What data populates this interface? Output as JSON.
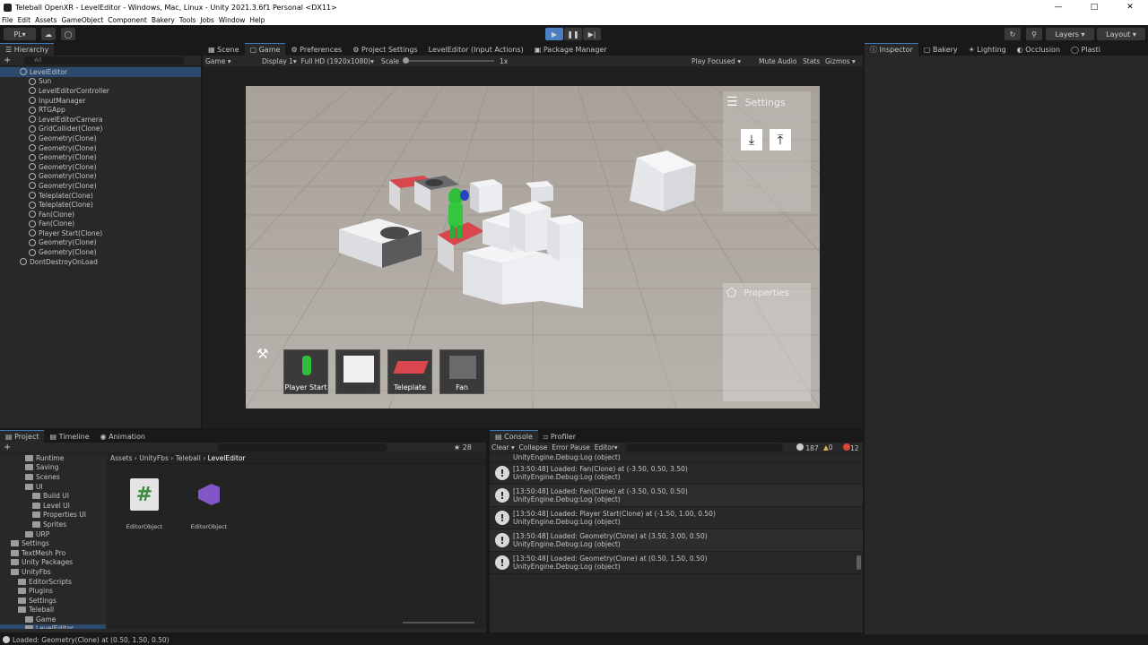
{
  "window": {
    "title": "Teleball OpenXR - LevelEditor - Windows, Mac, Linux - Unity 2021.3.6f1 Personal <DX11>"
  },
  "menu": [
    "File",
    "Edit",
    "Assets",
    "GameObject",
    "Component",
    "Bakery",
    "Tools",
    "Jobs",
    "Window",
    "Help"
  ],
  "toolbar": {
    "account": "PL",
    "layers": "Layers",
    "layout": "Layout"
  },
  "hierarchy": {
    "tab": "Hierarchy",
    "search_placeholder": "All",
    "scene": "LevelEditor",
    "items": [
      "Sun",
      "LevelEditorController",
      "InputManager",
      "RTGApp",
      "LevelEditorCamera",
      "GridCollider(Clone)",
      "Geometry(Clone)",
      "Geometry(Clone)",
      "Geometry(Clone)",
      "Geometry(Clone)",
      "Geometry(Clone)",
      "Geometry(Clone)",
      "Teleplate(Clone)",
      "Teleplate(Clone)",
      "Fan(Clone)",
      "Fan(Clone)",
      "Player Start(Clone)",
      "Geometry(Clone)",
      "Geometry(Clone)"
    ],
    "dontdestroy": "DontDestroyOnLoad"
  },
  "center_tabs": [
    "Scene",
    "Game",
    "Preferences",
    "Project Settings",
    "LevelEditor (Input Actions)",
    "Package Manager"
  ],
  "game_bar": {
    "mode": "Game",
    "display": "Display 1",
    "resolution": "Full HD (1920x1080)",
    "scale_label": "Scale",
    "scale_value": "1x",
    "play_focused": "Play Focused",
    "mute": "Mute Audio",
    "stats": "Stats",
    "gizmos": "Gizmos"
  },
  "game_view": {
    "settings_label": "Settings",
    "properties_label": "Properties",
    "hotbar": [
      "Player Start",
      "Geometry",
      "Teleplate",
      "Fan"
    ]
  },
  "right_tabs": [
    "Inspector",
    "Bakery",
    "Lighting",
    "Occlusion",
    "Plasti"
  ],
  "project": {
    "tabs": [
      "Project",
      "Timeline",
      "Animation"
    ],
    "add": "+",
    "count": "28",
    "breadcrumb": [
      "Assets",
      "UnityFbs",
      "Teleball",
      "LevelEditor"
    ],
    "tree": [
      {
        "label": "Runtime",
        "indent": 3
      },
      {
        "label": "Saving",
        "indent": 3
      },
      {
        "label": "Scenes",
        "indent": 3
      },
      {
        "label": "UI",
        "indent": 3
      },
      {
        "label": "Build UI",
        "indent": 4
      },
      {
        "label": "Level UI",
        "indent": 4
      },
      {
        "label": "Properties UI",
        "indent": 4
      },
      {
        "label": "Sprites",
        "indent": 4
      },
      {
        "label": "URP",
        "indent": 3
      },
      {
        "label": "Settings",
        "indent": 1
      },
      {
        "label": "TextMesh Pro",
        "indent": 1
      },
      {
        "label": "Unity Packages",
        "indent": 1
      },
      {
        "label": "UnityFbs",
        "indent": 1
      },
      {
        "label": "EditorScripts",
        "indent": 2
      },
      {
        "label": "Plugins",
        "indent": 2
      },
      {
        "label": "Settings",
        "indent": 2
      },
      {
        "label": "Teleball",
        "indent": 2
      },
      {
        "label": "Game",
        "indent": 3
      },
      {
        "label": "LevelEditor",
        "indent": 3
      }
    ],
    "assets": [
      {
        "name": "EditorObject",
        "icon": "csharp-script-icon"
      },
      {
        "name": "EditorObject",
        "icon": "visual-studio-icon"
      }
    ]
  },
  "console": {
    "tabs": [
      "Console",
      "Profiler"
    ],
    "buttons": [
      "Clear",
      "Collapse",
      "Error Pause",
      "Editor"
    ],
    "counts": {
      "info": "187",
      "warn": "0",
      "error": "12"
    },
    "first_partial": "UnityEngine.Debug:Log (object)",
    "entries": [
      {
        "line1": "[13:50:48] Loaded: Fan(Clone) at (-3.50, 0.50, 3.50)",
        "line2": "UnityEngine.Debug:Log (object)"
      },
      {
        "line1": "[13:50:48] Loaded: Fan(Clone) at (-3.50, 0.50, 0.50)",
        "line2": "UnityEngine.Debug:Log (object)"
      },
      {
        "line1": "[13:50:48] Loaded: Player Start(Clone) at (-1.50, 1.00, 0.50)",
        "line2": "UnityEngine.Debug:Log (object)"
      },
      {
        "line1": "[13:50:48] Loaded: Geometry(Clone) at (3.50, 3.00, 0.50)",
        "line2": "UnityEngine.Debug:Log (object)"
      },
      {
        "line1": "[13:50:48] Loaded: Geometry(Clone) at (0.50, 1.50, 0.50)",
        "line2": "UnityEngine.Debug:Log (object)"
      }
    ]
  },
  "status_bar": "Loaded: Geometry(Clone) at (0.50, 1.50, 0.50)",
  "colors": {
    "accent": "#3a79bb",
    "teleplate": "#d9464e",
    "player": "#2fbf3a"
  }
}
